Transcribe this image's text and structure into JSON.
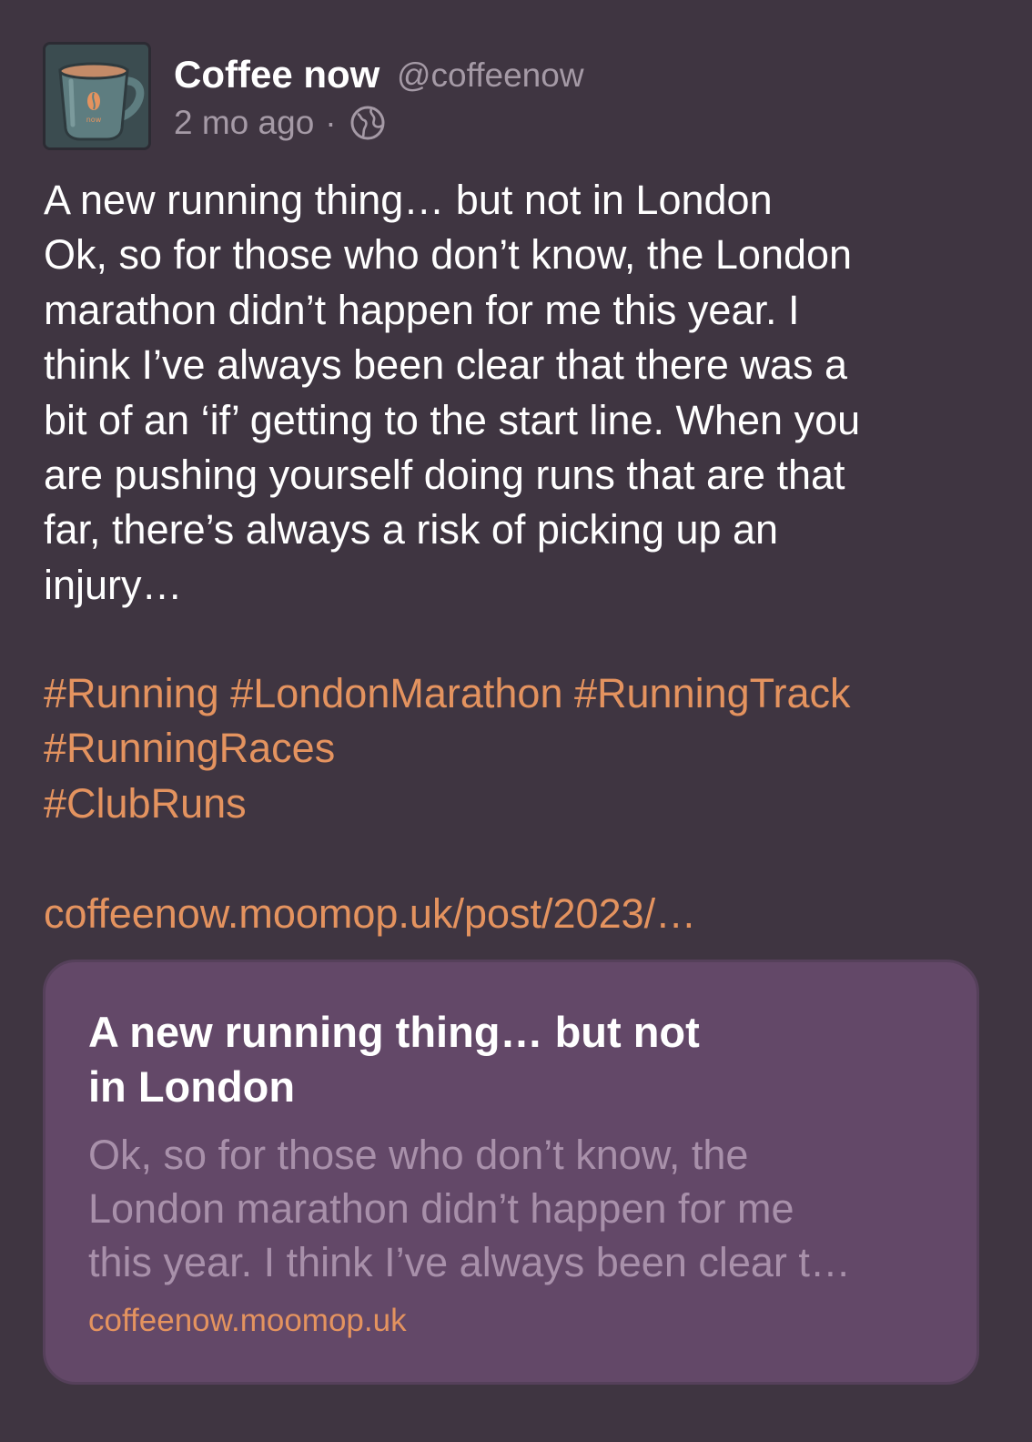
{
  "author": {
    "display_name": "Coffee now",
    "handle": "@coffeenow",
    "avatar_icon": "coffee-mug-icon",
    "avatar_mug_text": "now"
  },
  "meta": {
    "time": "2 mo ago",
    "separator": "·",
    "visibility_icon": "globe-icon"
  },
  "post": {
    "lines": [
      "A new running thing… but not in London",
      "Ok, so for those who don’t know, the London",
      "marathon didn’t happen for me this year. I",
      "think I’ve always been clear that there was a",
      "bit of an ‘if’ getting to the start line. When you",
      "are pushing yourself doing runs that are that",
      "far, there’s always a risk of picking up an",
      "injury…"
    ],
    "hashtags": [
      [
        "#Running",
        "#LondonMarathon",
        "#RunningTrack"
      ],
      [
        "#RunningRaces"
      ],
      [
        "#ClubRuns"
      ]
    ],
    "link": "coffeenow.moomop.uk/post/2023/…"
  },
  "link_card": {
    "title_lines": [
      "A new running thing… but not",
      "in London"
    ],
    "description_lines": [
      "Ok, so for those who don’t know, the",
      "London marathon didn’t happen for me",
      "this year. I think I’ve always been clear t…"
    ],
    "domain": "coffeenow.moomop.uk"
  },
  "colors": {
    "background": "#3f3541",
    "accent": "#e4935f",
    "muted": "#a59aa6",
    "card_background": "#634868",
    "card_muted": "#a890aa"
  }
}
